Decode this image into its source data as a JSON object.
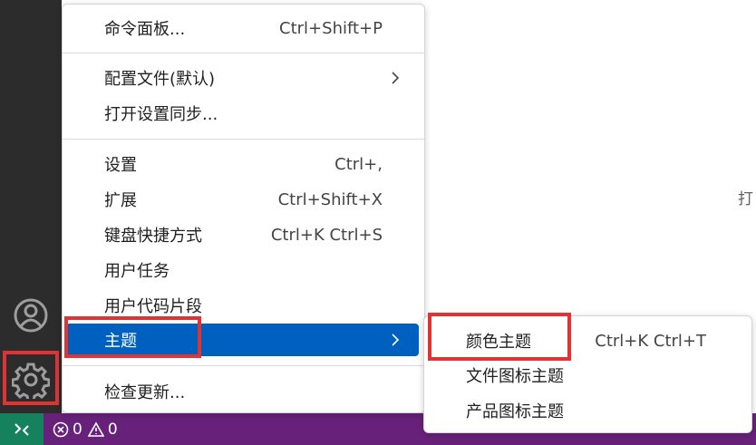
{
  "main_menu": {
    "items": [
      {
        "label": "命令面板...",
        "shortcut": "Ctrl+Shift+P"
      },
      {
        "label": "配置文件(默认)",
        "shortcut": ""
      },
      {
        "label": "打开设置同步...",
        "shortcut": ""
      },
      {
        "label": "设置",
        "shortcut": "Ctrl+,"
      },
      {
        "label": "扩展",
        "shortcut": "Ctrl+Shift+X"
      },
      {
        "label": "键盘快捷方式",
        "shortcut": "Ctrl+K Ctrl+S"
      },
      {
        "label": "用户任务",
        "shortcut": ""
      },
      {
        "label": "用户代码片段",
        "shortcut": ""
      },
      {
        "label": "主题",
        "shortcut": ""
      },
      {
        "label": "检查更新...",
        "shortcut": ""
      }
    ]
  },
  "theme_submenu": {
    "items": [
      {
        "label": "颜色主题",
        "shortcut": "Ctrl+K Ctrl+T"
      },
      {
        "label": "文件图标主题",
        "shortcut": ""
      },
      {
        "label": "产品图标主题",
        "shortcut": ""
      }
    ]
  },
  "editor": {
    "partial_text": "打"
  },
  "status_bar": {
    "errors": "0",
    "warnings": "0"
  },
  "colors": {
    "activity_bar": "#2c2c2c",
    "status_bar": "#68217a",
    "remote_button": "#16825d",
    "active_item": "#0060c0",
    "highlight": "#e03434"
  },
  "icons": [
    "account-icon",
    "gear-icon",
    "chevron-right-icon",
    "remote-icon",
    "error-icon",
    "warning-icon"
  ]
}
